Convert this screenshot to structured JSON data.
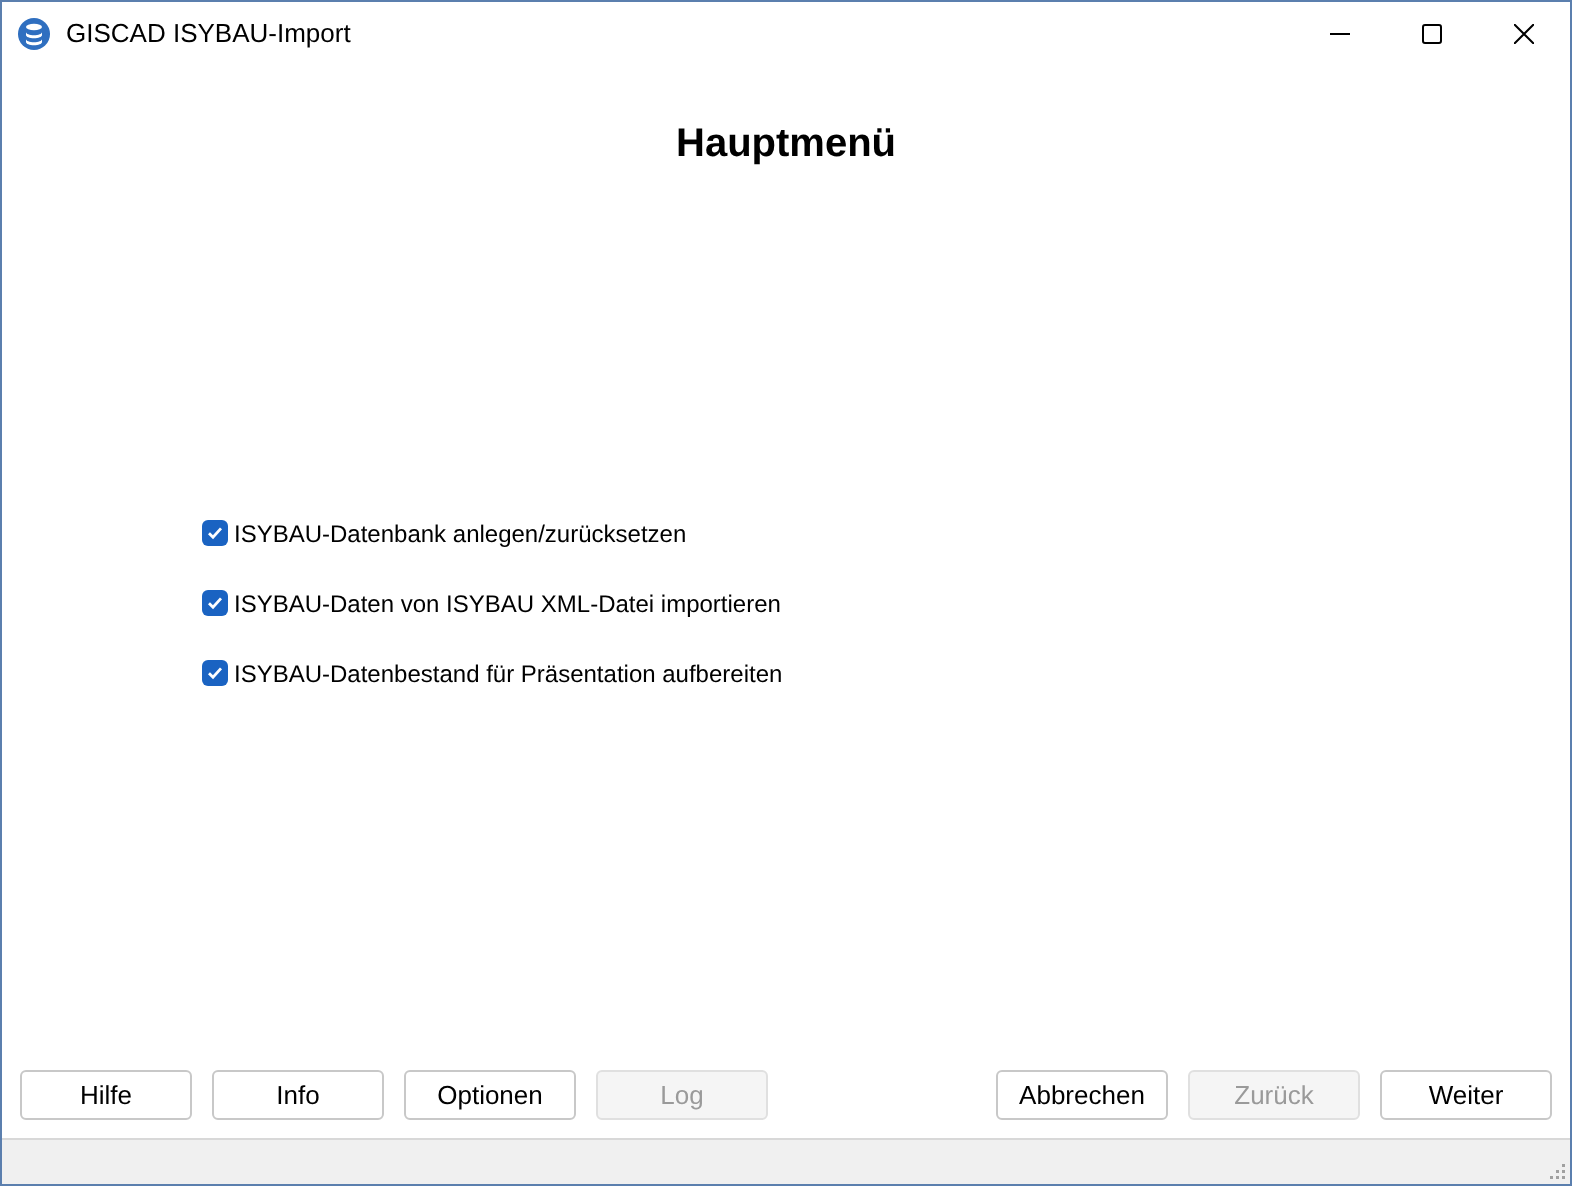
{
  "window": {
    "title": "GISCAD ISYBAU-Import"
  },
  "heading": "Hauptmenü",
  "options": [
    {
      "label": "ISYBAU-Datenbank anlegen/zurücksetzen",
      "checked": true
    },
    {
      "label": "ISYBAU-Daten von ISYBAU XML-Datei importieren",
      "checked": true
    },
    {
      "label": "ISYBAU-Datenbestand für Präsentation aufbereiten",
      "checked": true
    }
  ],
  "left_buttons": [
    {
      "label": "Hilfe",
      "disabled": false
    },
    {
      "label": "Info",
      "disabled": false
    },
    {
      "label": "Optionen",
      "disabled": false
    },
    {
      "label": "Log",
      "disabled": true
    }
  ],
  "right_buttons": [
    {
      "label": "Abbrechen",
      "disabled": false
    },
    {
      "label": "Zurück",
      "disabled": true
    },
    {
      "label": "Weiter",
      "disabled": false
    }
  ]
}
